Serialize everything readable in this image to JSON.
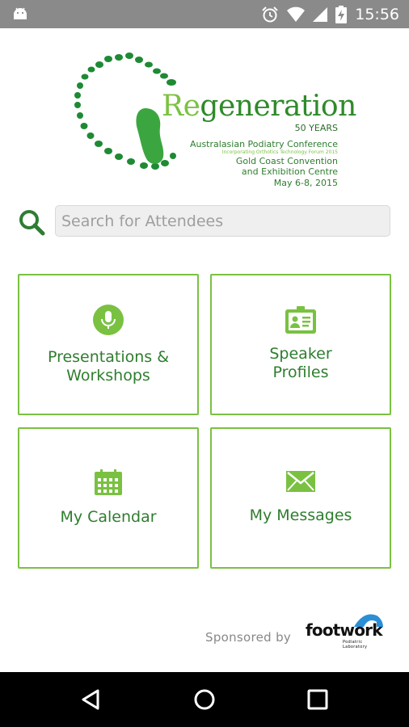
{
  "status_bar": {
    "time": "15:56",
    "icons": [
      "android-debug-icon",
      "alarm-icon",
      "wifi-icon",
      "cell-signal-icon",
      "battery-charging-icon"
    ]
  },
  "logo": {
    "title_re": "Re",
    "title_rest": "generation",
    "years": "50 YEARS",
    "conference": "Australasian Podiatry Conference",
    "forum": "Incorporating Orthotics Technology Forum 2015",
    "venue_line1": "Gold Coast Convention",
    "venue_line2": "and Exhibition Centre",
    "dates": "May 6-8, 2015"
  },
  "search": {
    "placeholder": "Search for Attendees",
    "value": ""
  },
  "tiles": [
    {
      "line1": "Presentations &",
      "line2": "Workshops",
      "icon": "microphone-icon"
    },
    {
      "line1": "Speaker",
      "line2": "Profiles",
      "icon": "id-card-icon"
    },
    {
      "line1": "My Calendar",
      "icon": "calendar-icon"
    },
    {
      "line1": "My Messages",
      "icon": "envelope-icon"
    }
  ],
  "sponsor": {
    "label": "Sponsored by",
    "brand": "footwork",
    "brand_sub": "Podiatric Laboratory"
  },
  "nav": {
    "icons": [
      "back-icon",
      "home-icon",
      "recents-icon"
    ]
  },
  "colors": {
    "accent": "#7ac142",
    "text_green": "#2f7d2f",
    "status_bar": "#8a8a8a",
    "nav_bar": "#000000",
    "brand_blue": "#2a8fd6"
  }
}
